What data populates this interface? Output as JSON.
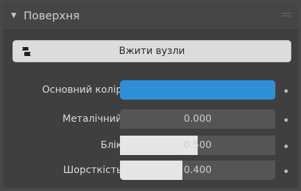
{
  "panel": {
    "title": "Поверхня",
    "use_nodes_label": "Вжити вузли"
  },
  "properties": {
    "base_color": {
      "label": "Основний колір",
      "color": "#2e8fd9"
    },
    "metallic": {
      "label": "Металічний",
      "value": "0.000",
      "fraction": 0.0
    },
    "specular": {
      "label": "Блік",
      "value": "0.500",
      "fraction": 0.5
    },
    "roughness": {
      "label": "Шорсткість",
      "value": "0.400",
      "fraction": 0.4
    }
  }
}
